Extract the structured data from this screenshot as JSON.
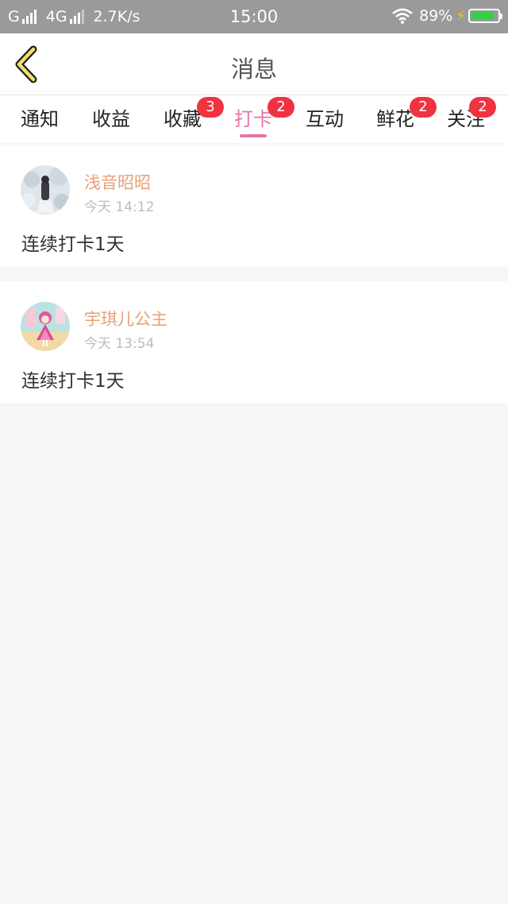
{
  "status_bar": {
    "network_left": "G",
    "network_mid": "4G",
    "speed": "2.7K/s",
    "time": "15:00",
    "battery_pct": "89%"
  },
  "header": {
    "title": "消息",
    "back_icon": "chevron-left-icon"
  },
  "tabs": [
    {
      "label": "通知",
      "badge": ""
    },
    {
      "label": "收益",
      "badge": ""
    },
    {
      "label": "收藏",
      "badge": "3"
    },
    {
      "label": "打卡",
      "badge": "2",
      "active": true
    },
    {
      "label": "互动",
      "badge": ""
    },
    {
      "label": "鲜花",
      "badge": "2"
    },
    {
      "label": "关注",
      "badge": "2"
    }
  ],
  "messages": [
    {
      "username": "浅音昭昭",
      "time": "今天 14:12",
      "content": "连续打卡1天"
    },
    {
      "username": "宇琪儿公主",
      "time": "今天 13:54",
      "content": "连续打卡1天"
    }
  ],
  "colors": {
    "accent_pink": "#e576a7",
    "username_orange": "#e7a178",
    "badge_red": "#ef3341",
    "status_bar_gray": "#9a9a9a"
  }
}
